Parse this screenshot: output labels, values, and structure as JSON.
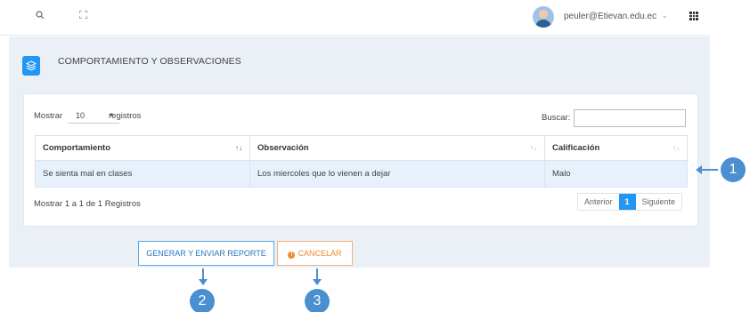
{
  "topbar": {
    "search_icon": "🔍",
    "expand_icon": "⛶",
    "user_email": "peuler@Etievan.edu.ec",
    "user_menu_chevron": "⌄"
  },
  "page": {
    "title": "COMPORTAMIENTO Y OBSERVACIONES",
    "title_icon": "≋"
  },
  "table_controls": {
    "show_label": "Mostrar",
    "page_length": "10",
    "records_label": "registros",
    "search_label": "Buscar:",
    "search_value": ""
  },
  "table": {
    "columns": [
      "Comportamiento",
      "Observación",
      "Calificación"
    ],
    "rows": [
      [
        "Se sienta mal en clases",
        "Los miercoles que lo vienen a dejar",
        "Malo"
      ]
    ]
  },
  "table_footer": {
    "info": "Mostrar 1 a 1 de 1 Registros",
    "prev": "Anterior",
    "current_page": "1",
    "next": "Siguiente"
  },
  "actions": {
    "report_button": "GENERAR Y ENVIAR REPORTE",
    "cancel_button": "CANCELAR",
    "cancel_icon": "!"
  },
  "annotations": {
    "marker_1": "1",
    "marker_2": "2",
    "marker_3": "3"
  },
  "colors": {
    "accent": "#2196f3",
    "marker": "#4a8fcf",
    "cancel": "#f08a2e"
  }
}
